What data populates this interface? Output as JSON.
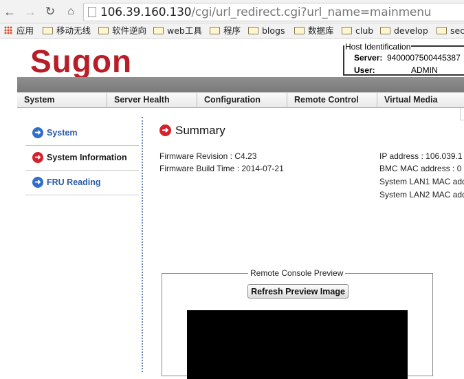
{
  "browser": {
    "url_host": "106.39.160.130",
    "url_path": "/cgi/url_redirect.cgi?url_name=mainmenu",
    "bookmarks": [
      "应用",
      "移动无线",
      "软件逆向",
      "web工具",
      "程序",
      "blogs",
      "数据库",
      "club",
      "develop",
      "sec"
    ]
  },
  "header": {
    "logo": "Sugon",
    "host_identification": {
      "legend": "Host Identification",
      "server_label": "Server:",
      "server_value": "9400007500445387",
      "user_label": "User:",
      "user_value": "ADMIN"
    }
  },
  "menu": [
    "System",
    "Server Health",
    "Configuration",
    "Remote Control",
    "Virtual Media"
  ],
  "sidebar": {
    "items": [
      {
        "label": "System",
        "icon": "blue-arrow-icon",
        "selected": false
      },
      {
        "label": "System Information",
        "icon": "red-arrow-icon",
        "selected": true
      },
      {
        "label": "FRU Reading",
        "icon": "blue-arrow-icon",
        "selected": false
      }
    ]
  },
  "summary": {
    "title": "Summary",
    "firmware_revision_label": "Firmware Revision :",
    "firmware_revision_value": "C4.23",
    "firmware_build_label": "Firmware Build Time :",
    "firmware_build_value": "2014-07-21",
    "ip_label": "IP address :",
    "ip_value": "106.039.1",
    "bmc_mac_label": "BMC MAC address :",
    "bmc_mac_value": "0",
    "lan1_label": "System LAN1 MAC add",
    "lan2_label": "System LAN2 MAC add"
  },
  "console": {
    "legend": "Remote Console Preview",
    "refresh_button": "Refresh Preview Image"
  },
  "colors": {
    "brand_red": "#b81e28",
    "link_blue": "#2a5ba8",
    "menu_band": "#808080"
  }
}
